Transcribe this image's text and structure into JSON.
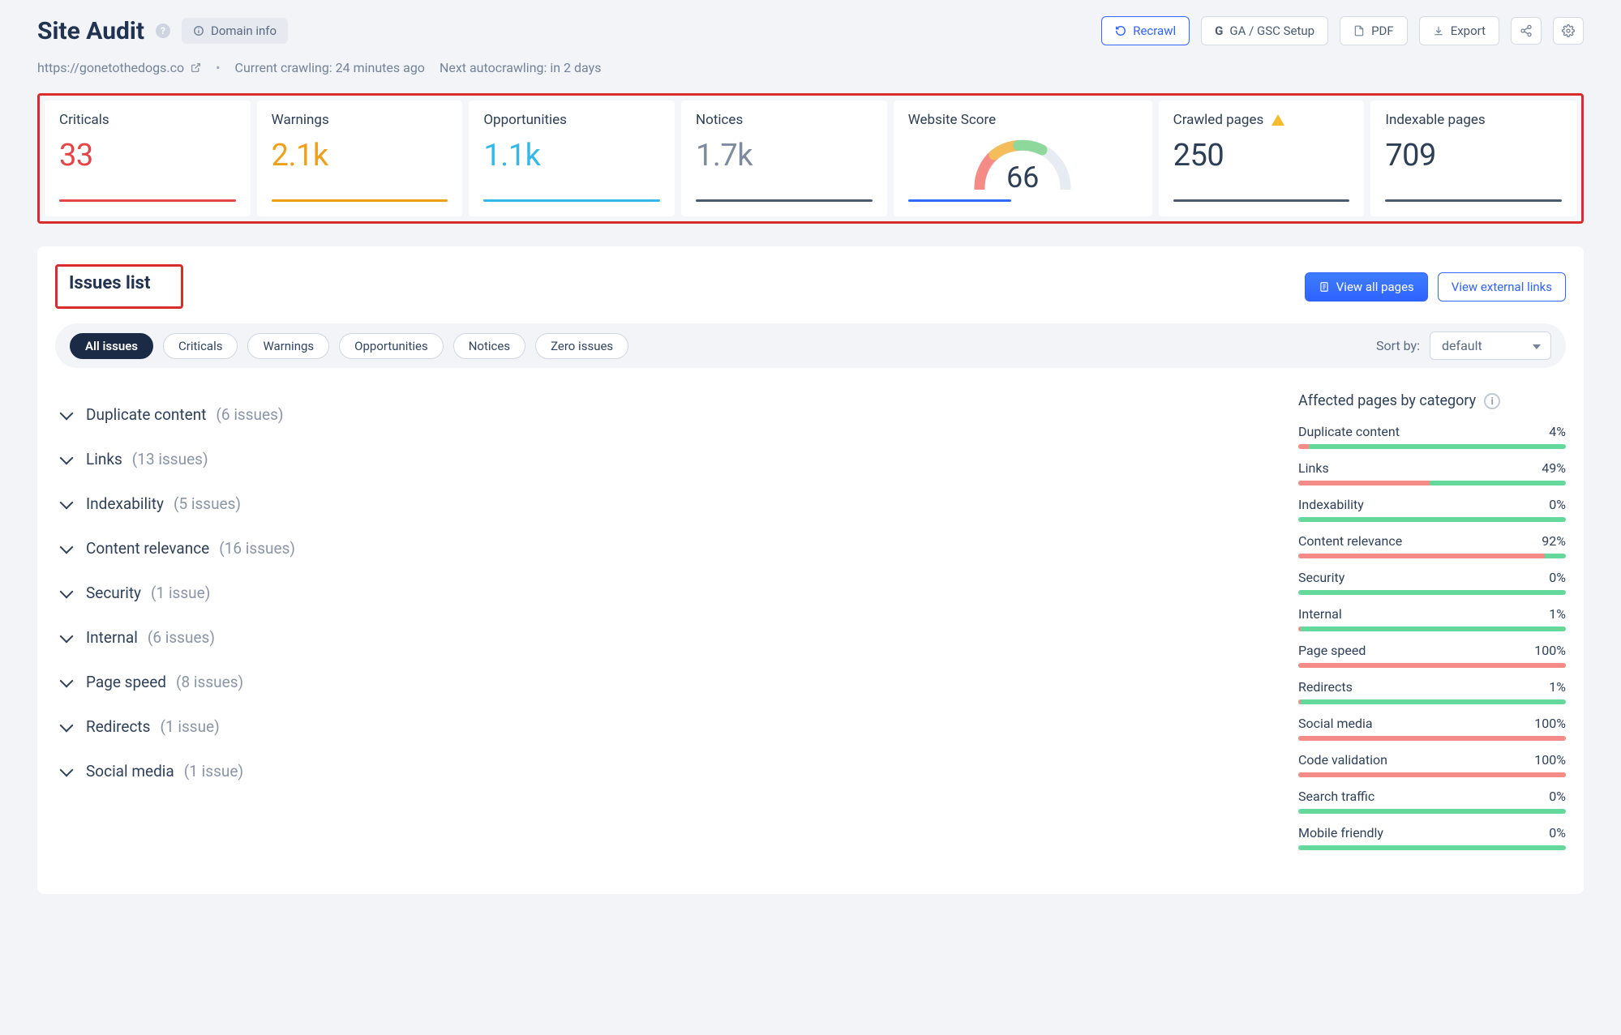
{
  "header": {
    "title": "Site Audit",
    "domain_info_label": "Domain info",
    "recrawl": "Recrawl",
    "ga_gsc": "GA / GSC Setup",
    "pdf": "PDF",
    "export": "Export"
  },
  "sub": {
    "url": "https://gonetothedogs.co",
    "crawling": "Current crawling: 24 minutes ago",
    "autocrawl": "Next autocrawling: in 2 days"
  },
  "cards": {
    "criticals_lbl": "Criticals",
    "criticals_val": "33",
    "warnings_lbl": "Warnings",
    "warnings_val": "2.1k",
    "opps_lbl": "Opportunities",
    "opps_val": "1.1k",
    "notices_lbl": "Notices",
    "notices_val": "1.7k",
    "score_lbl": "Website Score",
    "score_val": "66",
    "crawled_lbl": "Crawled pages",
    "crawled_val": "250",
    "index_lbl": "Indexable pages",
    "index_val": "709"
  },
  "issues": {
    "title": "Issues list",
    "view_all": "View all pages",
    "view_ext": "View external links",
    "sort_label": "Sort by:",
    "sort_value": "default",
    "filters": {
      "all": "All issues",
      "criticals": "Criticals",
      "warnings": "Warnings",
      "opportunities": "Opportunities",
      "notices": "Notices",
      "zero": "Zero issues"
    },
    "list": [
      {
        "name": "Duplicate content",
        "count": "(6 issues)"
      },
      {
        "name": "Links",
        "count": "(13 issues)"
      },
      {
        "name": "Indexability",
        "count": "(5 issues)"
      },
      {
        "name": "Content relevance",
        "count": "(16 issues)"
      },
      {
        "name": "Security",
        "count": "(1 issue)"
      },
      {
        "name": "Internal",
        "count": "(6 issues)"
      },
      {
        "name": "Page speed",
        "count": "(8 issues)"
      },
      {
        "name": "Redirects",
        "count": "(1 issue)"
      },
      {
        "name": "Social media",
        "count": "(1 issue)"
      }
    ]
  },
  "affected": {
    "title": "Affected pages by category",
    "rows": [
      {
        "name": "Duplicate content",
        "pct": "4%",
        "fill": 4
      },
      {
        "name": "Links",
        "pct": "49%",
        "fill": 49
      },
      {
        "name": "Indexability",
        "pct": "0%",
        "fill": 0
      },
      {
        "name": "Content relevance",
        "pct": "92%",
        "fill": 92
      },
      {
        "name": "Security",
        "pct": "0%",
        "fill": 0
      },
      {
        "name": "Internal",
        "pct": "1%",
        "fill": 1
      },
      {
        "name": "Page speed",
        "pct": "100%",
        "fill": 100
      },
      {
        "name": "Redirects",
        "pct": "1%",
        "fill": 1
      },
      {
        "name": "Social media",
        "pct": "100%",
        "fill": 100
      },
      {
        "name": "Code validation",
        "pct": "100%",
        "fill": 100
      },
      {
        "name": "Search traffic",
        "pct": "0%",
        "fill": 0
      },
      {
        "name": "Mobile friendly",
        "pct": "0%",
        "fill": 0
      }
    ]
  }
}
